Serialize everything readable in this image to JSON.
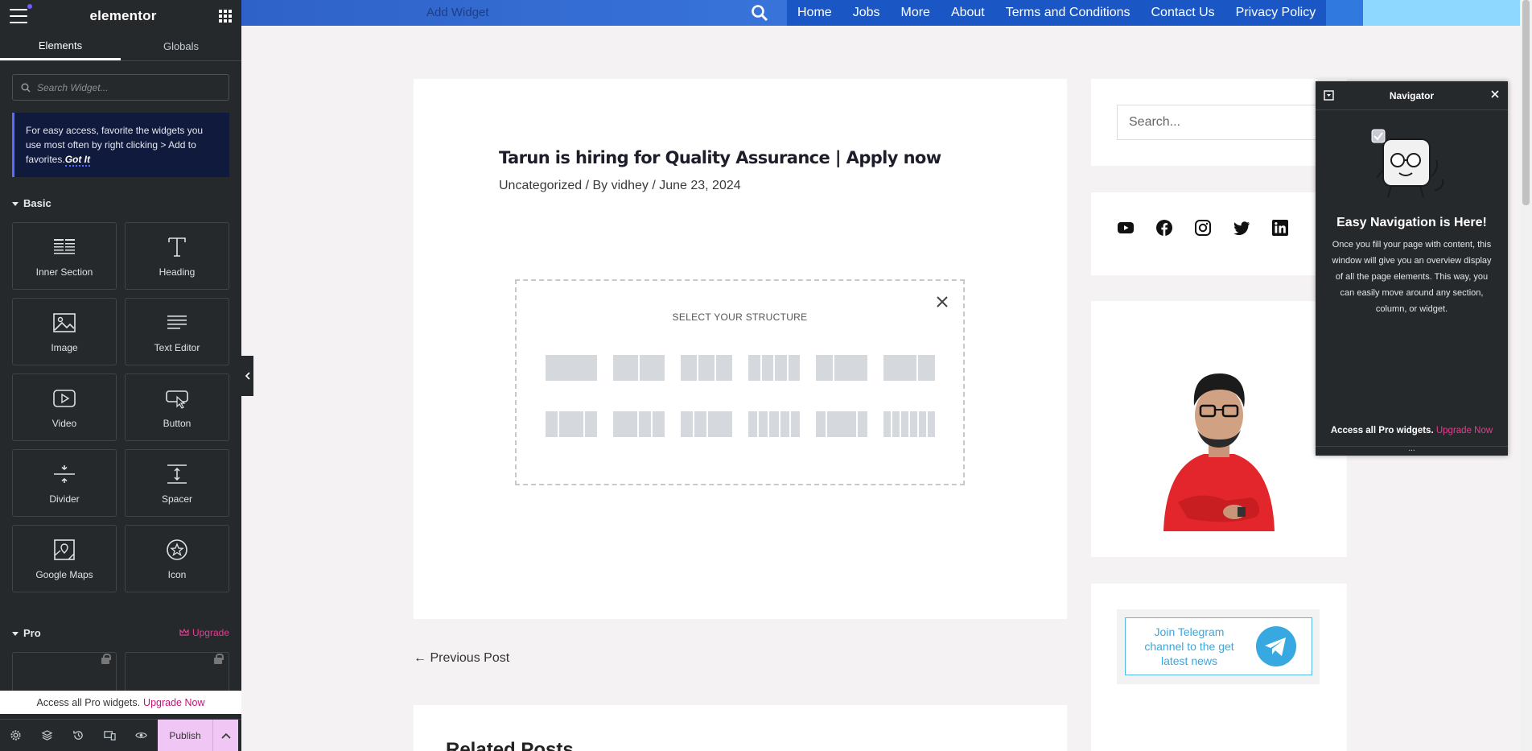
{
  "panel": {
    "logo": "elementor",
    "tabs": [
      {
        "label": "Elements"
      },
      {
        "label": "Globals"
      }
    ],
    "search_placeholder": "Search Widget...",
    "notice": {
      "text": "For easy access, favorite the widgets you use most often by right clicking > Add to favorites.",
      "link": "Got It"
    },
    "basic_label": "Basic",
    "widgets": [
      {
        "label": "Inner Section",
        "icon": "inner-section-icon"
      },
      {
        "label": "Heading",
        "icon": "heading-icon"
      },
      {
        "label": "Image",
        "icon": "image-icon"
      },
      {
        "label": "Text Editor",
        "icon": "text-editor-icon"
      },
      {
        "label": "Video",
        "icon": "video-icon"
      },
      {
        "label": "Button",
        "icon": "button-icon"
      },
      {
        "label": "Divider",
        "icon": "divider-icon"
      },
      {
        "label": "Spacer",
        "icon": "spacer-icon"
      },
      {
        "label": "Google Maps",
        "icon": "google-maps-icon"
      },
      {
        "label": "Icon",
        "icon": "star-icon"
      }
    ],
    "pro_label": "Pro",
    "upgrade_label": "Upgrade",
    "pro_bar": {
      "text": "Access all Pro widgets.",
      "link": "Upgrade Now"
    },
    "publish_label": "Publish"
  },
  "topnav": {
    "add_widget": "Add Widget",
    "menu": [
      {
        "label": "Home"
      },
      {
        "label": "Jobs"
      },
      {
        "label": "More"
      },
      {
        "label": "About"
      },
      {
        "label": "Terms and Conditions"
      },
      {
        "label": "Contact Us"
      },
      {
        "label": "Privacy Policy"
      }
    ]
  },
  "article": {
    "title": "Tarun is hiring for Quality Assurance | Apply now",
    "category": "Uncategorized",
    "by": " / By ",
    "author": "vidhey",
    "sep": " / ",
    "date": "June 23, 2024"
  },
  "structure": {
    "title": "SELECT YOUR STRUCTURE"
  },
  "prev_post": "← Previous Post",
  "related_title": "Related Posts",
  "sidebar": {
    "search_placeholder": "Search...",
    "telegram": "Join Telegram channel to the get latest news"
  },
  "navigator": {
    "title": "Navigator",
    "heading": "Easy Navigation is Here!",
    "text": "Once you fill your page with content, this window will give you an overview display of all the page elements. This way, you can easily move around any section, column, or widget.",
    "pro_text": "Access all Pro widgets.",
    "pro_link": "Upgrade Now",
    "foot": "..."
  },
  "colors": {
    "panel_bg": "#26292c",
    "accent_pink": "#e23e8e",
    "nav_blue": "#1a57c4",
    "telegram_blue": "#37a8e0"
  }
}
